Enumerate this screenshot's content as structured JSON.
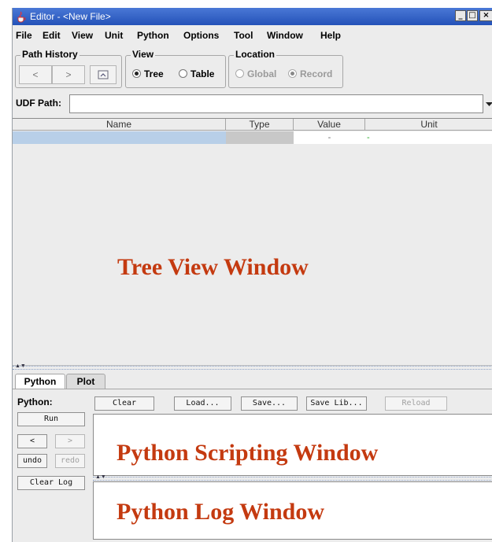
{
  "window": {
    "title": "Editor - <New File>",
    "min": "_",
    "max": "□",
    "close": "×"
  },
  "menu": [
    "File",
    "Edit",
    "View",
    "Unit",
    "Python",
    "Options",
    "Tool",
    "Window",
    "Help"
  ],
  "path_history": {
    "title": "Path History",
    "back": "<",
    "forward": ">"
  },
  "view_group": {
    "title": "View",
    "tree": "Tree",
    "table": "Table",
    "selected": "Tree"
  },
  "location_group": {
    "title": "Location",
    "global": "Global",
    "record": "Record",
    "selected": "Record",
    "enabled": false
  },
  "udf": {
    "label": "UDF Path:",
    "value": ""
  },
  "table": {
    "columns": [
      "Name",
      "Type",
      "Value",
      "Unit"
    ],
    "row": {
      "name": "",
      "type": "",
      "value": "-",
      "unit": "-"
    }
  },
  "tree_view_label": "Tree   View   Window",
  "tabs": [
    "Python",
    "Plot"
  ],
  "python": {
    "label": "Python:",
    "run": "Run",
    "back": "<",
    "forward": ">",
    "undo": "undo",
    "redo": "redo",
    "clear_log": "Clear Log",
    "toolbar": [
      "Clear",
      "Load...",
      "Save...",
      "Save Lib...",
      "Reload"
    ],
    "scripting_label": "Python   Scripting   Window",
    "log_label": "Python   Log   Window"
  },
  "colors": {
    "titlebar": "#2c5cc4",
    "annotation": "#c43a10",
    "selection": "#b8cfe8"
  }
}
